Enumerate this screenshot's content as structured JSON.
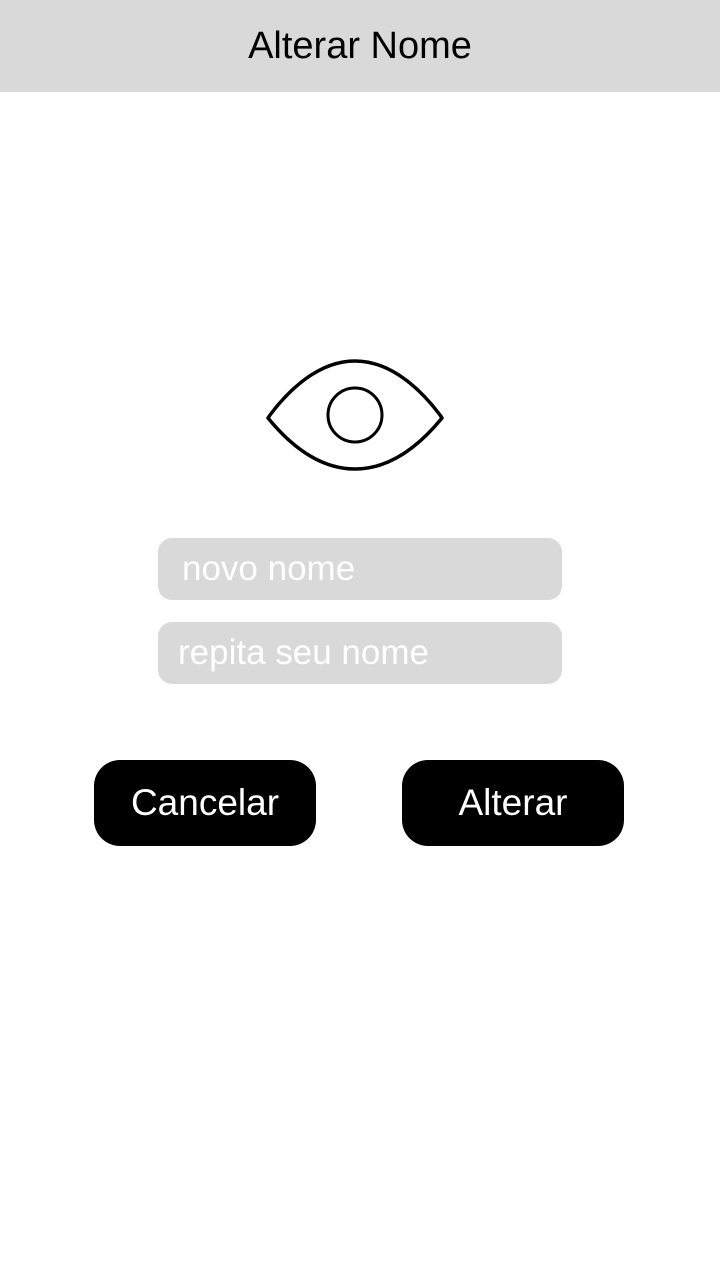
{
  "header": {
    "title": "Alterar Nome"
  },
  "icon": {
    "name": "eye-icon"
  },
  "form": {
    "new_name_placeholder": "novo nome",
    "repeat_name_placeholder": "repita seu nome"
  },
  "actions": {
    "cancel_label": "Cancelar",
    "confirm_label": "Alterar"
  },
  "colors": {
    "header_bg": "#d9d9d9",
    "field_bg": "#d9d9d9",
    "button_bg": "#000000",
    "button_text": "#ffffff"
  }
}
